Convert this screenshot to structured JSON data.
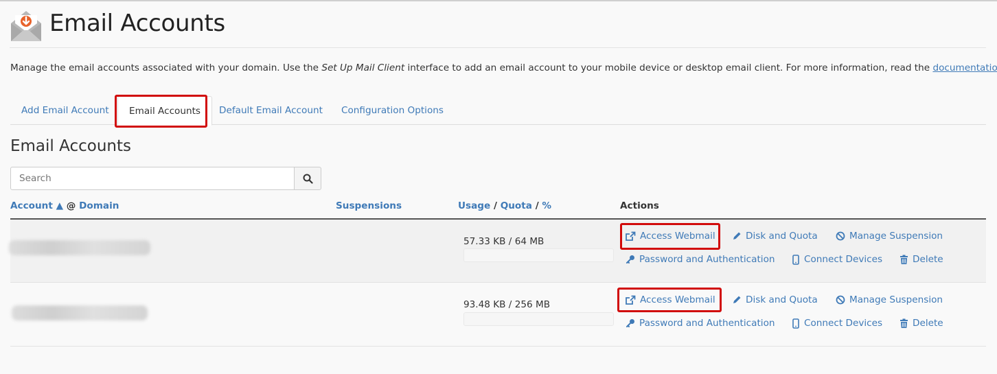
{
  "header": {
    "title": "Email Accounts",
    "icon": "envelope-download-icon"
  },
  "intro": {
    "part1": "Manage the email accounts associated with your domain. Use the ",
    "em": "Set Up Mail Client",
    "part2": " interface to add an email account to your mobile device or desktop email client. For more information, read the ",
    "link": "documentation",
    "end": "."
  },
  "tabs": [
    {
      "label": "Add Email Account"
    },
    {
      "label": "Email Accounts",
      "active": true
    },
    {
      "label": "Default Email Account"
    },
    {
      "label": "Configuration Options"
    }
  ],
  "section_title": "Email Accounts",
  "search": {
    "placeholder": "Search",
    "value": ""
  },
  "columns": {
    "account": "Account",
    "sort_indicator": "▲",
    "at": "@",
    "domain": "Domain",
    "suspensions": "Suspensions",
    "usage": "Usage",
    "quota": "Quota",
    "percent": "%",
    "sep": "/",
    "actions": "Actions"
  },
  "actions": {
    "access_webmail": "Access Webmail",
    "disk_quota": "Disk and Quota",
    "manage_suspension": "Manage Suspension",
    "password_auth": "Password and Authentication",
    "connect_devices": "Connect Devices",
    "delete": "Delete"
  },
  "rows": [
    {
      "usage": "57.33 KB / 64 MB",
      "usage_fraction": 0.0009
    },
    {
      "usage": "93.48 KB / 256 MB",
      "usage_fraction": 0.0004
    }
  ],
  "colors": {
    "link": "#3f7ab7",
    "highlight": "#d10a0a",
    "icon_orange": "#e8622a"
  }
}
